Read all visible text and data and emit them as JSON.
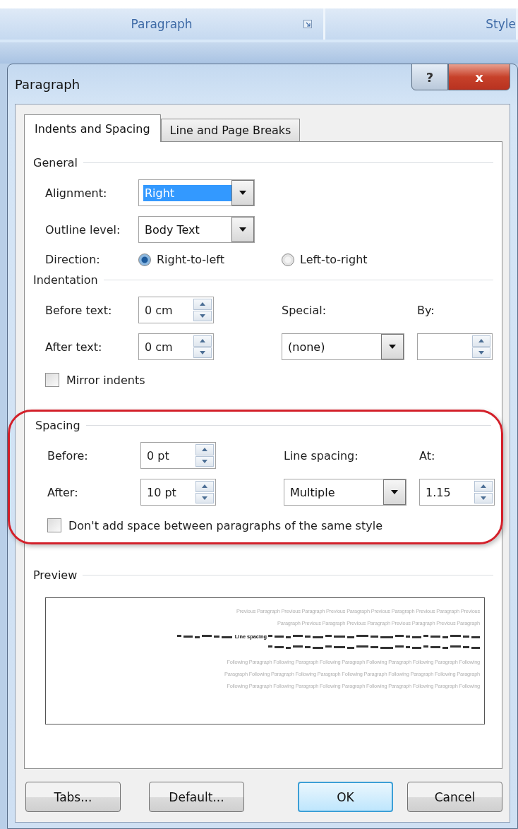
{
  "ribbon": {
    "groups": [
      {
        "label": "Paragraph",
        "launcher": true
      },
      {
        "label": "Style",
        "launcher": false
      }
    ]
  },
  "dialog": {
    "title": "Paragraph",
    "title_buttons": [
      {
        "kind": "help",
        "label": "?"
      },
      {
        "kind": "close",
        "label": "x"
      }
    ]
  },
  "tabs": [
    {
      "label": "Indents and Spacing",
      "selected": true
    },
    {
      "label": "Line and Page Breaks",
      "selected": false
    }
  ],
  "general": {
    "heading": "General",
    "alignment": {
      "label": "Alignment:",
      "value": "Right",
      "focused": true
    },
    "outline_level": {
      "label": "Outline level:",
      "value": "Body Text",
      "focused": false
    },
    "direction": {
      "label": "Direction:",
      "options": [
        {
          "label": "Right-to-left",
          "selected": true
        },
        {
          "label": "Left-to-right",
          "selected": false
        }
      ]
    }
  },
  "indentation": {
    "heading": "Indentation",
    "before_text": {
      "label": "Before text:",
      "value": "0 cm"
    },
    "after_text": {
      "label": "After text:",
      "value": "0 cm"
    },
    "special": {
      "label": "Special:",
      "value": "(none)"
    },
    "by": {
      "label": "By:"
    },
    "mirror_indents": {
      "label": "Mirror indents",
      "checked": false
    }
  },
  "spacing": {
    "heading": "Spacing",
    "highlighted": true,
    "before": {
      "label": "Before:",
      "value": "0 pt"
    },
    "after": {
      "label": "After:",
      "value": "10 pt"
    },
    "line_spacing": {
      "label": "Line spacing:",
      "value": "Multiple"
    },
    "at": {
      "label": "At:",
      "value": "1.15"
    },
    "dont_add_space": {
      "label": "Don't add space between paragraphs of the same style",
      "checked": false
    }
  },
  "preview": {
    "heading": "Preview",
    "previous": [
      "Previous Paragraph Previous Paragraph Previous Paragraph Previous Paragraph Previous Paragraph Previous",
      "Paragraph Previous Paragraph Previous Paragraph Previous Paragraph Previous Paragraph"
    ],
    "current_marker": "Line spacing",
    "following": [
      "Following Paragraph Following Paragraph Following Paragraph Following Paragraph Following Paragraph Following",
      "Paragraph Following Paragraph Following Paragraph Following Paragraph Following Paragraph Following Paragraph",
      "Following Paragraph Following Paragraph Following Paragraph Following Paragraph Following Paragraph Following"
    ]
  },
  "buttons": [
    {
      "label": "Tabs...",
      "default": false
    },
    {
      "label": "Default...",
      "default": false
    },
    {
      "label": "OK",
      "default": true
    },
    {
      "label": "Cancel",
      "default": false
    }
  ]
}
